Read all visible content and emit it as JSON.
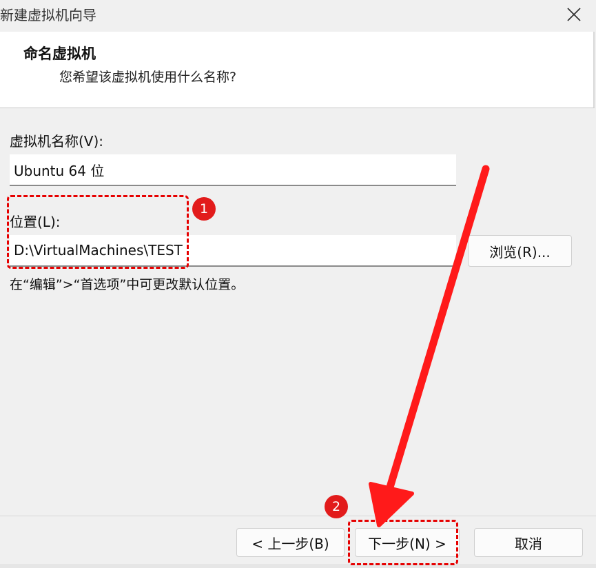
{
  "window": {
    "title": "新建虚拟机向导",
    "close_icon": "close-icon"
  },
  "header": {
    "title": "命名虚拟机",
    "subtitle": "您希望该虚拟机使用什么名称?"
  },
  "form": {
    "name_label": "虚拟机名称(V):",
    "name_value": "Ubuntu 64 位",
    "location_label": "位置(L):",
    "location_value": "D:\\VirtualMachines\\TEST",
    "browse_label": "浏览(R)...",
    "hint": "在“编辑”>“首选项”中可更改默认位置。"
  },
  "footer": {
    "back_label": "< 上一步(B)",
    "next_label": "下一步(N) >",
    "cancel_label": "取消"
  },
  "annotations": {
    "badge_1": "1",
    "badge_2": "2",
    "highlight_color": "#e60000"
  }
}
